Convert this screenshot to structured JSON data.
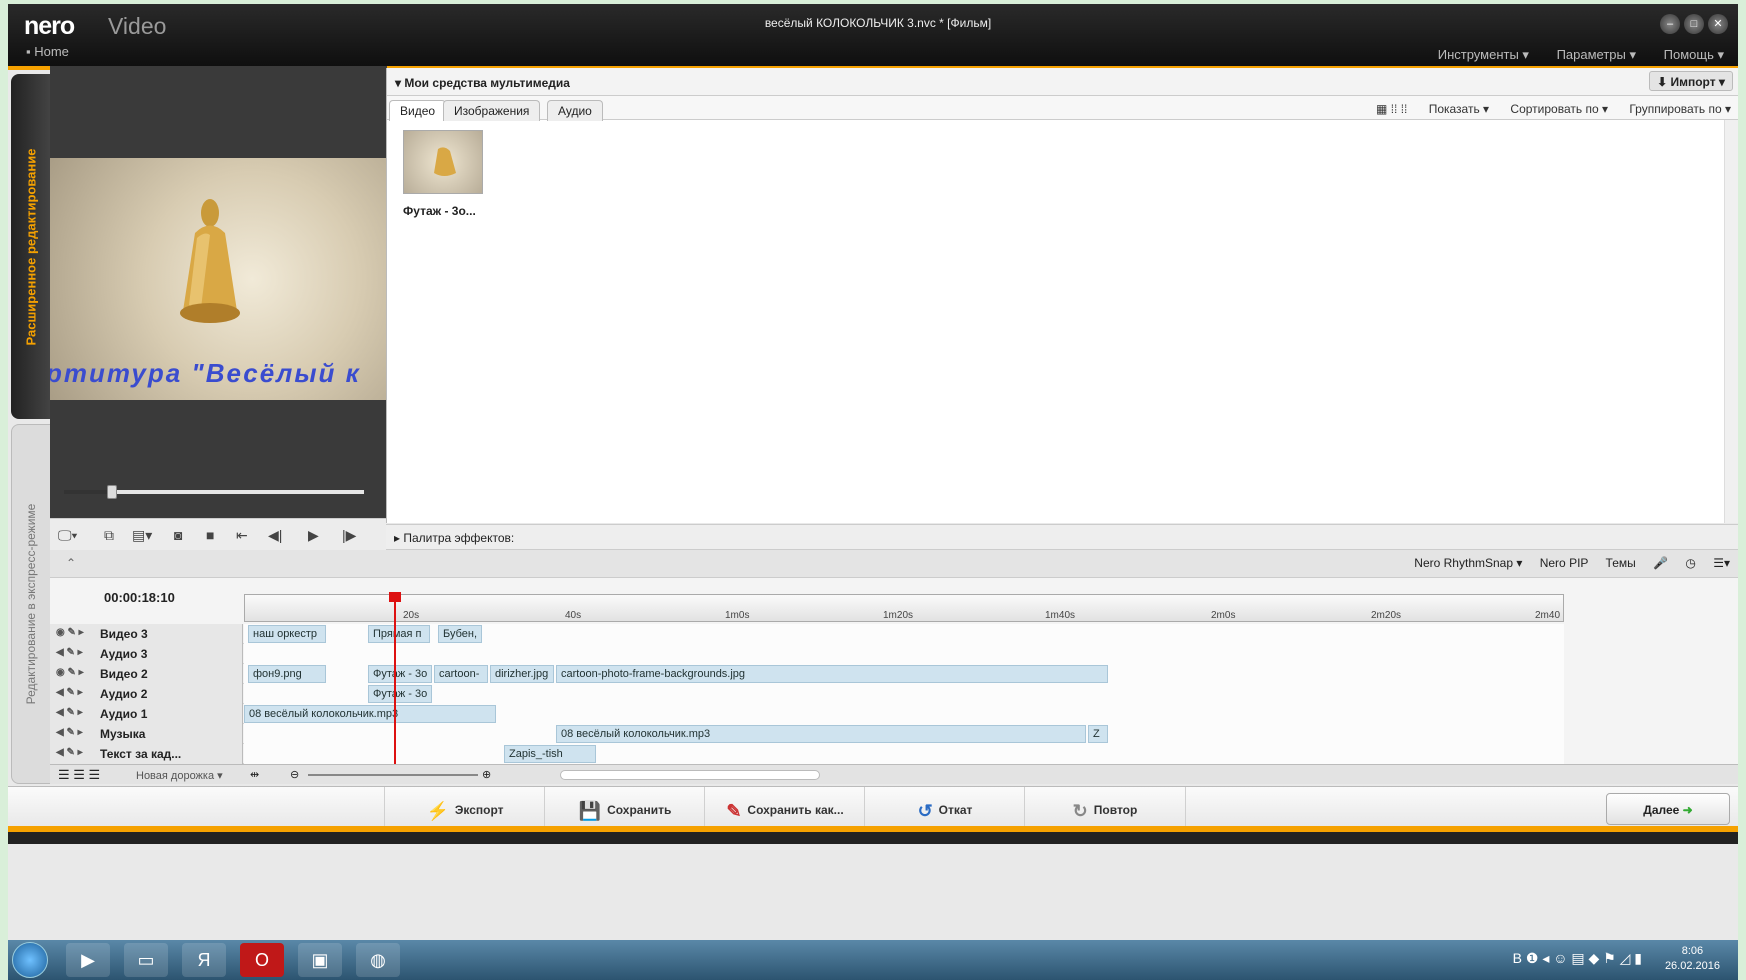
{
  "app": {
    "logo": "nero",
    "logo_sub": "Video",
    "window_title": "весёлый КОЛОКОЛЬЧИК 3.nvc * [Фильм]",
    "home": "Home",
    "menu": [
      "Инструменты ▾",
      "Параметры ▾",
      "Помощь ▾"
    ],
    "accent": "#f5a100"
  },
  "side_tabs": {
    "advanced": "Расширенное редактирование",
    "express": "Редактирование в экспресс-режиме"
  },
  "preview": {
    "caption": "ртитура \"Весёлый  к",
    "progress": 0.16
  },
  "media": {
    "header": "▾ Мои средства мультимедиа",
    "import": "⬇ Импорт ▾",
    "tabs": [
      "Видео",
      "Изображения",
      "Аудио"
    ],
    "options": [
      "Показать ▾",
      "Сортировать по ▾",
      "Группировать по ▾"
    ],
    "item_label": "Футаж - 3о..."
  },
  "effects": "▸ Палитра эффектов:",
  "timeline_tools": [
    "Nero RhythmSnap ▾",
    "Nero PIP",
    "Темы"
  ],
  "timeline": {
    "timecode": "00:00:18:10",
    "ticks": [
      "20s",
      "40s",
      "1m0s",
      "1m20s",
      "1m40s",
      "2m0s",
      "2m20s",
      "2m40"
    ],
    "tracks": [
      {
        "name": "Видео 3",
        "clips": [
          "наш оркестр",
          "Прямая п",
          "Бубен,"
        ]
      },
      {
        "name": "Аудио 3",
        "clips": []
      },
      {
        "name": "Видео 2",
        "clips": [
          "фон9.png",
          "Футаж - 3о",
          "cartoon-",
          "dirizher.jpg",
          "cartoon-photo-frame-backgrounds.jpg"
        ]
      },
      {
        "name": "Аудио 2",
        "clips": [
          "Футаж - 3о"
        ]
      },
      {
        "name": "Аудио 1",
        "clips": [
          "08 весёлый колокольчик.mp3"
        ]
      },
      {
        "name": "Музыка",
        "clips": [
          "08 весёлый колокольчик.mp3",
          "Z"
        ]
      },
      {
        "name": "Текст за кад...",
        "clips": [
          "Zapis_-tish"
        ]
      }
    ],
    "new_track": "Новая дорожка ▾"
  },
  "actions": {
    "export": "Экспорт",
    "save": "Сохранить",
    "save_as": "Сохранить как...",
    "undo": "Откат",
    "redo": "Повтор",
    "next": "Далее"
  },
  "taskbar": {
    "time": "8:06",
    "date": "26.02.2016"
  }
}
